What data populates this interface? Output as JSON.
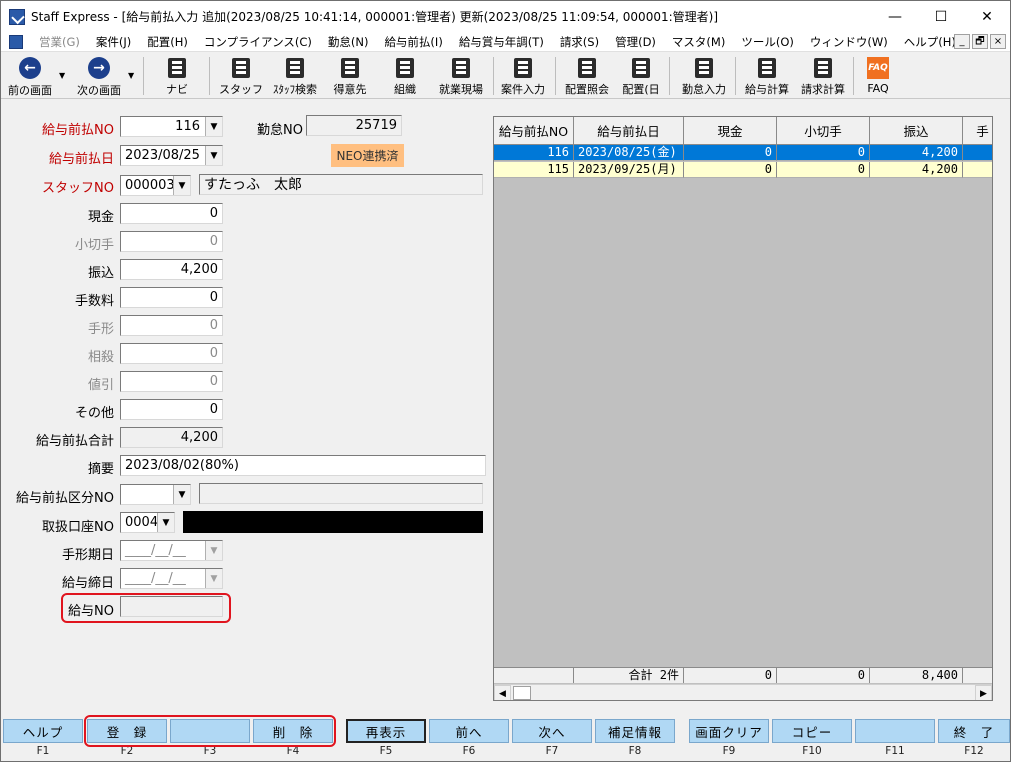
{
  "window": {
    "title": "Staff Express - [給与前払入力 追加(2023/08/25 10:41:14, 000001:管理者) 更新(2023/08/25 11:09:54, 000001:管理者)]",
    "controls": {
      "minimize": "—",
      "maximize": "☐",
      "close": "✕"
    }
  },
  "menu": {
    "items": [
      "営業(G)",
      "案件(J)",
      "配置(H)",
      "コンプライアンス(C)",
      "勤怠(N)",
      "給与前払(I)",
      "給与賞与年調(T)",
      "請求(S)",
      "管理(D)",
      "マスタ(M)",
      "ツール(O)",
      "ウィンドウ(W)",
      "ヘルプ(H)"
    ],
    "mdi": {
      "minimize": "_",
      "restore": "🗗",
      "close": "×"
    }
  },
  "toolbar": {
    "back": "前の画面",
    "forward": "次の画面",
    "navi": "ナビ",
    "staff": "スタッフ",
    "staff_search": "ｽﾀｯﾌ検索",
    "client": "得意先",
    "org": "組織",
    "worksite": "就業現場",
    "job_entry": "案件入力",
    "placement_inquiry": "配置照会",
    "placement_day": "配置(日",
    "attendance": "勤怠入力",
    "payroll_calc": "給与計算",
    "invoice_calc": "請求計算",
    "faq": "FAQ",
    "faq_icon_text": "FAQ",
    "arrow_left": "←",
    "arrow_right": "→",
    "dropdown": "▼"
  },
  "form": {
    "advance_no_label": "給与前払NO",
    "advance_no": "116",
    "attendance_no_label": "勤怠NO",
    "attendance_no": "25719",
    "advance_date_label": "給与前払日",
    "advance_date": "2023/08/25",
    "neo_badge": "NEO連携済",
    "staff_no_label": "スタッフNO",
    "staff_no": "000003",
    "staff_name": "すたっふ　太郎",
    "cash_label": "現金",
    "cash": "0",
    "check_label": "小切手",
    "check": "0",
    "transfer_label": "振込",
    "transfer": "4,200",
    "fee_label": "手数料",
    "fee": "0",
    "bill_label": "手形",
    "bill": "0",
    "offset_label": "相殺",
    "offset": "0",
    "discount_label": "値引",
    "discount": "0",
    "other_label": "その他",
    "other": "0",
    "total_label": "給与前払合計",
    "total": "4,200",
    "memo_label": "摘要",
    "memo": "2023/08/02(80%)",
    "category_label": "給与前払区分NO",
    "category": "",
    "category_name": "",
    "account_label": "取扱口座NO",
    "account": "0004",
    "bill_due_label": "手形期日",
    "bill_due": "____/__/__",
    "payroll_close_label": "給与締日",
    "payroll_close": "____/__/__",
    "payroll_no_label": "給与NO",
    "payroll_no": "",
    "dropdown": "▼"
  },
  "grid": {
    "columns": [
      "給与前払NO",
      "給与前払日",
      "現金",
      "小切手",
      "振込",
      "手"
    ],
    "rows": [
      {
        "no": "116",
        "date": "2023/08/25(金)",
        "cash": "0",
        "check": "0",
        "transfer": "4,200",
        "selected": true
      },
      {
        "no": "115",
        "date": "2023/09/25(月)",
        "cash": "0",
        "check": "0",
        "transfer": "4,200",
        "selected": false
      }
    ],
    "footer": {
      "label": "合計 2件",
      "cash": "0",
      "check": "0",
      "transfer": "8,400"
    },
    "scroll_left": "◀",
    "scroll_right": "▶"
  },
  "fkeys": [
    {
      "label": "ヘルプ",
      "key": "F1"
    },
    {
      "label": "登　録",
      "key": "F2"
    },
    {
      "label": "",
      "key": "F3"
    },
    {
      "label": "削　除",
      "key": "F4"
    },
    {
      "label": "再表示",
      "key": "F5"
    },
    {
      "label": "前へ",
      "key": "F6"
    },
    {
      "label": "次へ",
      "key": "F7"
    },
    {
      "label": "補足情報",
      "key": "F8"
    },
    {
      "label": "画面クリア",
      "key": "F9"
    },
    {
      "label": "コピー",
      "key": "F10"
    },
    {
      "label": "",
      "key": "F11"
    },
    {
      "label": "終　了",
      "key": "F12"
    }
  ],
  "colors": {
    "required_label": "#c00000",
    "selected_row": "#0078d7",
    "alt_row": "#ffffd0",
    "fkey_bg": "#b0d8f4",
    "neo_badge": "#ffbf80",
    "highlight_box": "#e0141e"
  }
}
